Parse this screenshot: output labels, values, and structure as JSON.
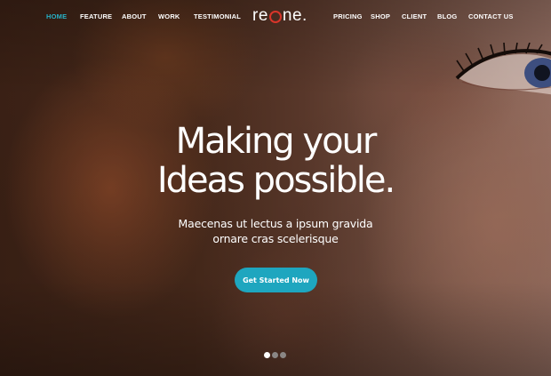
{
  "nav": {
    "left_items": [
      {
        "label": "HOME",
        "active": true
      },
      {
        "label": "FEATURE",
        "active": false
      },
      {
        "label": "ABOUT",
        "active": false
      },
      {
        "label": "WORK",
        "active": false
      },
      {
        "label": "TESTIMONIAL",
        "active": false
      }
    ],
    "right_items": [
      {
        "label": "PRICING",
        "active": false
      },
      {
        "label": "SHOP",
        "active": false
      },
      {
        "label": "CLIENT",
        "active": false
      },
      {
        "label": "BLOG",
        "active": false
      },
      {
        "label": "CONTACT US",
        "active": false
      }
    ],
    "active_color": "#26b0c6"
  },
  "logo": {
    "prefix": "re",
    "suffix": "ne.",
    "accent_color": "#d8352a"
  },
  "hero": {
    "headline_line1": "Making your",
    "headline_line2": "Ideas possible.",
    "subline_line1": "Maecenas ut lectus a ipsum gravida",
    "subline_line2": "ornare cras scelerisque",
    "cta_label": "Get Started Now",
    "cta_color": "#1ea6bf"
  },
  "slider": {
    "total": 3,
    "active_index": 0
  }
}
